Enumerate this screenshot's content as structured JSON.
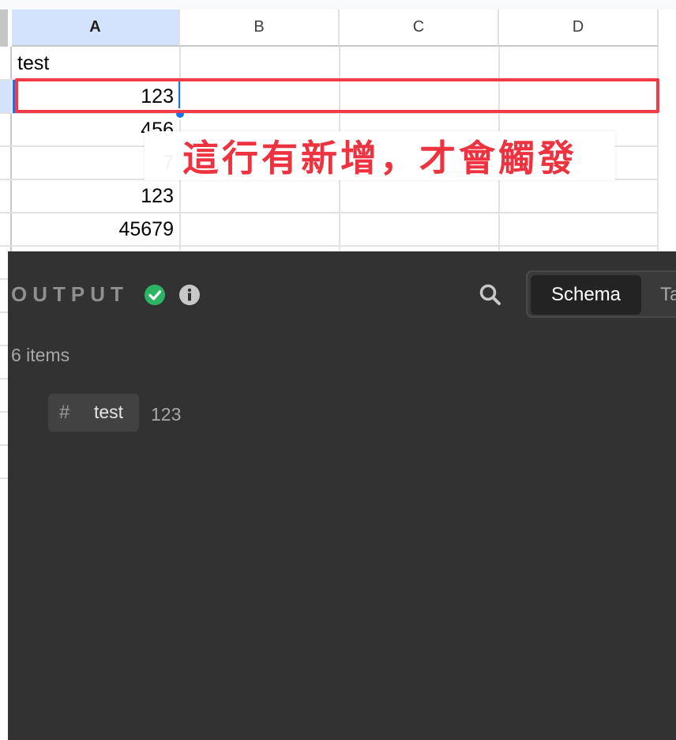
{
  "sheet": {
    "columns": [
      "A",
      "B",
      "C",
      "D"
    ],
    "header_value": "test",
    "values": [
      "123",
      "456",
      "7",
      "123",
      "45679"
    ]
  },
  "annotation": "這行有新增，才會觸發",
  "output": {
    "title": "OUTPUT",
    "status": "success",
    "items_count": "6 items",
    "tabs": [
      "Schema",
      "Ta"
    ],
    "field": {
      "type_symbol": "#",
      "name": "test",
      "value": "123"
    }
  },
  "colors": {
    "selection_blue": "#1a73e8",
    "highlight_red": "#f23a48",
    "success_green": "#2bb463",
    "panel_bg": "#323232"
  }
}
